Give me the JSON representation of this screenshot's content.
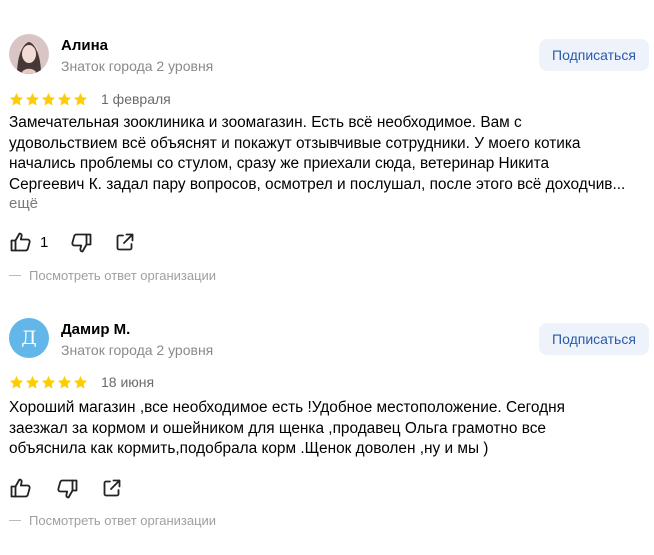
{
  "reviews": [
    {
      "author": "Алина",
      "level": "Знаток города 2 уровня",
      "subscribe_label": "Подписаться",
      "rating": 5,
      "date": "1 февраля",
      "text_lines": [
        "Замечательная зооклиника и зоомагазин. Есть всё необходимое. Вам с",
        "удовольствием всё объяснят и покажут отзывчивые сотрудники. У моего котика",
        "начались проблемы со стулом, сразу же приехали сюда, ветеринар Никита",
        "Сергеевич К. задал пару вопросов, осмотрел и послушал, после этого всё доходчив..."
      ],
      "more_label": "ещё",
      "like_count": "1",
      "org_reply_label": "Посмотреть ответ организации"
    },
    {
      "author": "Дамир М.",
      "avatar_letter": "Д",
      "level": "Знаток города 2 уровня",
      "subscribe_label": "Подписаться",
      "rating": 5,
      "date": "18 июня",
      "text_lines": [
        "Хороший магазин ,все необходимое есть !Удобное местоположение. Сегодня",
        "заезжал за кормом и ошейником для щенка ,продавец Ольга грамотно все",
        "объяснила как кормить,подобрала корм .Щенок доволен ,ну и мы )"
      ],
      "like_count": "",
      "org_reply_label": "Посмотреть ответ организации"
    }
  ],
  "colors": {
    "star": "#fc0",
    "subscribe_bg": "#eef3fb",
    "subscribe_text": "#2a5aa8",
    "avatar_letter_bg": "#62b6e8",
    "muted_text": "#8a8a8a"
  },
  "icons": {
    "like": "thumb-up-icon",
    "dislike": "thumb-down-icon",
    "share": "share-icon",
    "star": "star-icon"
  }
}
